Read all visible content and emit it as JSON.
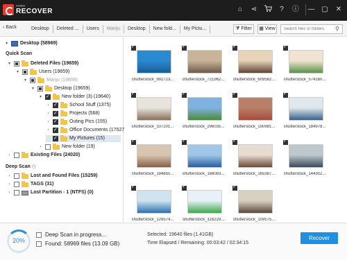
{
  "app": {
    "brand_top": "remo",
    "brand": "RECOVER"
  },
  "titlebar": {
    "icons": [
      "home-icon",
      "share-icon",
      "cart-icon",
      "help-icon",
      "info-icon",
      "minimize-icon",
      "maximize-icon",
      "close-icon"
    ],
    "glyphs": [
      "⌂",
      "⋖",
      "🛒",
      "?",
      "ⓘ",
      "—",
      "▢",
      "✕"
    ]
  },
  "nav": {
    "back": "Back",
    "breadcrumbs": [
      "Desktop",
      "Deleted ...",
      "Users",
      "Manju",
      "Desktop",
      "New fold...",
      "My Pictu..."
    ],
    "filter": "Filter",
    "view": "View",
    "search_placeholder": "Search files or folders"
  },
  "tree": {
    "desktop_root": "Desktop (58969)",
    "quick_scan": "Quick Scan",
    "deleted_files": "Deleted Files (19659)",
    "users": "Users (19659)",
    "manju": "Manju (19659)",
    "desktop": "Desktop (19659)",
    "new_folder3": "New folder (3) (19640)",
    "school_stuff": "School Stuff (1375)",
    "projects": "Projects (568)",
    "outing_pics": "Outing Pics (155)",
    "office_docs": "Office Documents (17527)",
    "my_pictures": "My Pictures (15)",
    "new_folder": "New folder (19)",
    "existing_files": "Existing Files (24020)",
    "deep_scan": "Deep Scan",
    "lost_found": "Lost and Found Files (15259)",
    "tags": "TAGS (31)",
    "lost_partition": "Lost Partition - 1 (NTFS) (0)"
  },
  "files": [
    "shutterstock_992723...",
    "shutterstock_721962...",
    "shutterstock_609582...",
    "shutterstock_574160...",
    "shutterstock_337201...",
    "shutterstock_296035...",
    "shutterstock_190981...",
    "shutterstock_184978...",
    "shutterstock_184855...",
    "shutterstock_168083...",
    "shutterstock_165387...",
    "shutterstock_144302...",
    "shutterstock_129574...",
    "shutterstock_116229...",
    "shutterstock_109575..."
  ],
  "thumb_colors": [
    [
      "#2a8ad0",
      "#1a5e98"
    ],
    [
      "#c9b49a",
      "#6d5a48"
    ],
    [
      "#e6d3b8",
      "#5f4535"
    ],
    [
      "#f0e4d0",
      "#5a8f4a"
    ],
    [
      "#e8e4dc",
      "#8a6e5a"
    ],
    [
      "#7fb2e0",
      "#4b8a3a"
    ],
    [
      "#b88066",
      "#a84a3c"
    ],
    [
      "#dfe8ec",
      "#3a5f8a"
    ],
    [
      "#d8c5b0",
      "#8a5f4a"
    ],
    [
      "#9fc7e8",
      "#2a5fa0"
    ],
    [
      "#e8dcd0",
      "#6a4a3a"
    ],
    [
      "#bcc8cc",
      "#3a4a5a"
    ],
    [
      "#d0e4f0",
      "#2f6fb0"
    ],
    [
      "#e8f0f8",
      "#3ea84a"
    ],
    [
      "#d8d0c0",
      "#5a4a3e"
    ]
  ],
  "status": {
    "percent": "20%",
    "progress": 0.2,
    "line1": "Deep Scan in progress...",
    "line2": "Found: 58969 files (13.09 GB)",
    "selected": "Selected: 19640 files (1.41GB)",
    "time": "Time Elapsed / Remaining: 00:03:42 / 02:34:15",
    "recover": "Recover"
  },
  "colors": {
    "accent": "#1e8fe1",
    "titlebar": "#1d1d1d",
    "selection": "#dfe7f1",
    "folder": "#f5c542"
  }
}
